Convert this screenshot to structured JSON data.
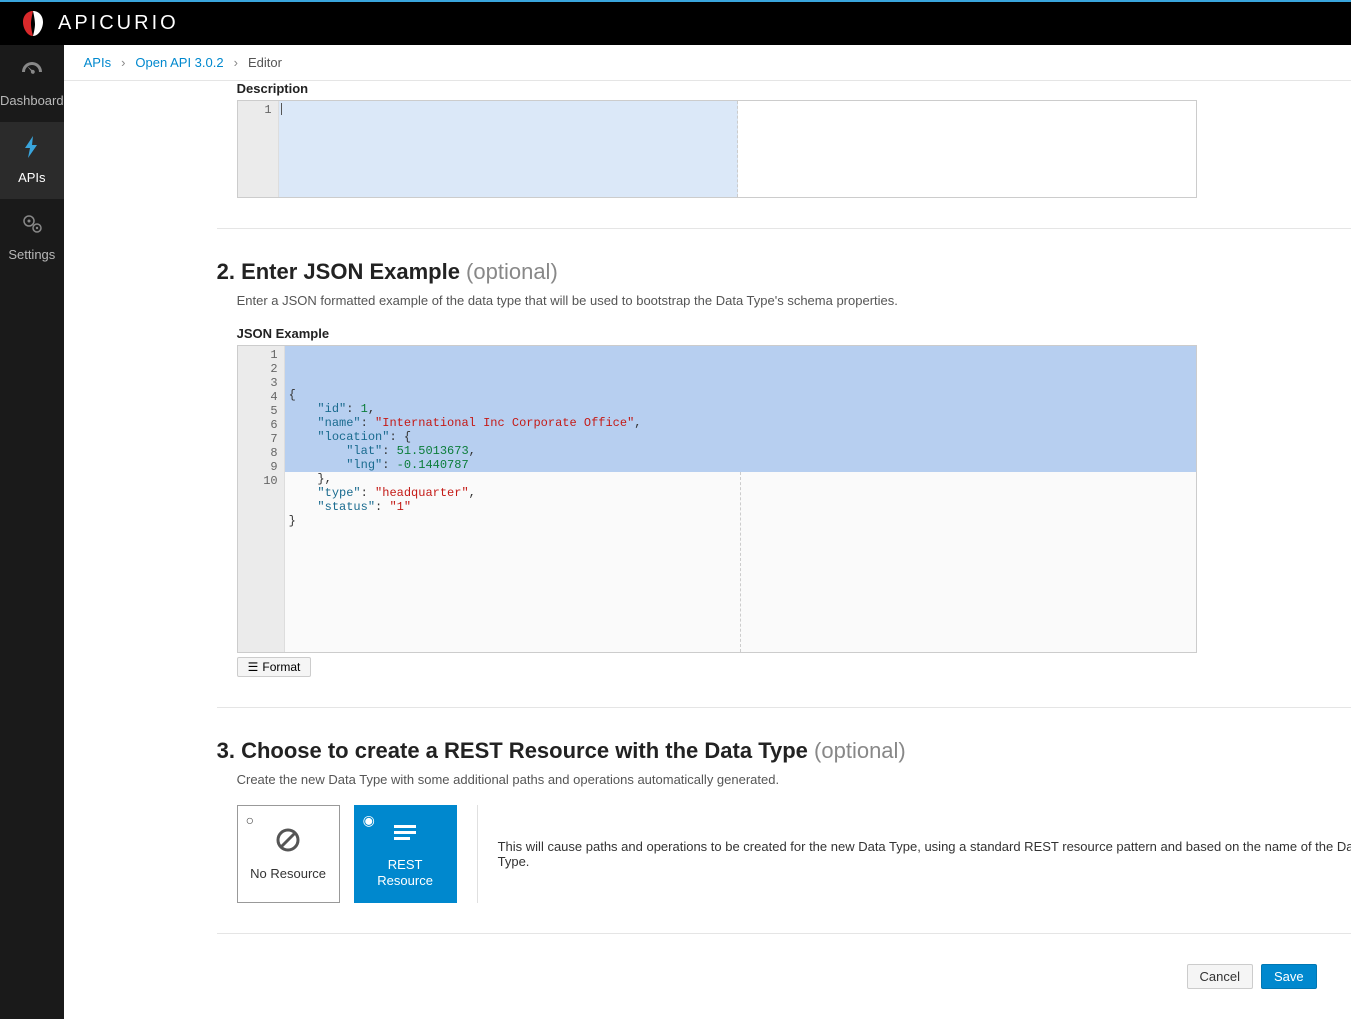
{
  "app": {
    "name": "APICURIO"
  },
  "sidebar": {
    "items": [
      {
        "label": "Dashboard"
      },
      {
        "label": "APIs"
      },
      {
        "label": "Settings"
      }
    ]
  },
  "breadcrumb": {
    "a": "APIs",
    "b": "Open API 3.0.2",
    "c": "Editor"
  },
  "desc": {
    "label": "Description"
  },
  "step2": {
    "title": "2. Enter JSON Example ",
    "optional": "(optional)",
    "help": "Enter a JSON formatted example of the data type that will be used to bootstrap the Data Type's schema properties.",
    "label": "JSON Example",
    "format": "Format",
    "json": {
      "id_key": "\"id\"",
      "id_val": "1",
      "name_key": "\"name\"",
      "name_val": "\"International Inc Corporate Office\"",
      "loc_key": "\"location\"",
      "lat_key": "\"lat\"",
      "lat_val": "51.5013673",
      "lng_key": "\"lng\"",
      "lng_val": "-0.1440787",
      "type_key": "\"type\"",
      "type_val": "\"headquarter\"",
      "status_key": "\"status\"",
      "status_val": "\"1\""
    }
  },
  "step3": {
    "title": "3. Choose to create a REST Resource with the Data Type ",
    "optional": "(optional)",
    "help": "Create the new Data Type with some additional paths and operations automatically generated.",
    "no_label": "No Resource",
    "rest_label": "REST Resource",
    "desc": "This will cause paths and operations to be created for the new Data Type, using a standard REST resource pattern and based on the name of the Data Type."
  },
  "footer": {
    "cancel": "Cancel",
    "save": "Save"
  }
}
